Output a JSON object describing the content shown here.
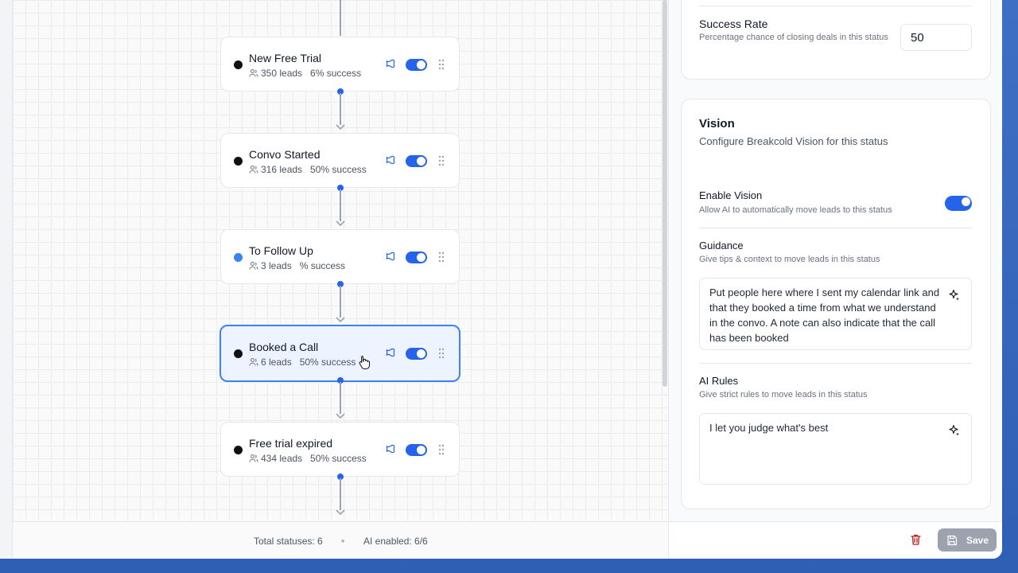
{
  "flow": {
    "nodes": [
      {
        "name": "New Free Trial",
        "leads": "350 leads",
        "success": "6% success",
        "bullet_color": "#111111"
      },
      {
        "name": "Convo Started",
        "leads": "316 leads",
        "success": "50% success",
        "bullet_color": "#111111"
      },
      {
        "name": "To Follow Up",
        "leads": "3 leads",
        "success": "% success",
        "bullet_color": "#3b82f6"
      },
      {
        "name": "Booked a Call",
        "leads": "6 leads",
        "success": "50% success",
        "bullet_color": "#111111",
        "selected": true
      },
      {
        "name": "Free trial expired",
        "leads": "434 leads",
        "success": "50% success",
        "bullet_color": "#111111"
      }
    ],
    "footer": {
      "total": "Total statuses: 6",
      "separator": "•",
      "ai_enabled": "AI enabled: 6/6"
    }
  },
  "settings": {
    "success_rate": {
      "label": "Success Rate",
      "hint": "Percentage chance of closing deals in this status",
      "value": "50"
    },
    "vision": {
      "title": "Vision",
      "subtitle": "Configure Breakcold Vision for this status",
      "enable_label": "Enable Vision",
      "enable_hint": "Allow AI to automatically move leads to this status",
      "enabled": true,
      "guidance_label": "Guidance",
      "guidance_hint": "Give tips & context to move leads in this status",
      "guidance_text": "Put people here where I sent my calendar link and that they booked a time from what we understand in the convo. A note can also indicate that the call has been booked",
      "rules_label": "AI Rules",
      "rules_hint": "Give strict rules to move leads in this status",
      "rules_text": "I let you judge what's best"
    },
    "save_label": "Save"
  },
  "colors": {
    "accent": "#2563eb",
    "selected_bg": "#eef4ff",
    "save_disabled": "#9ca3af",
    "delete": "#b91c1c"
  }
}
